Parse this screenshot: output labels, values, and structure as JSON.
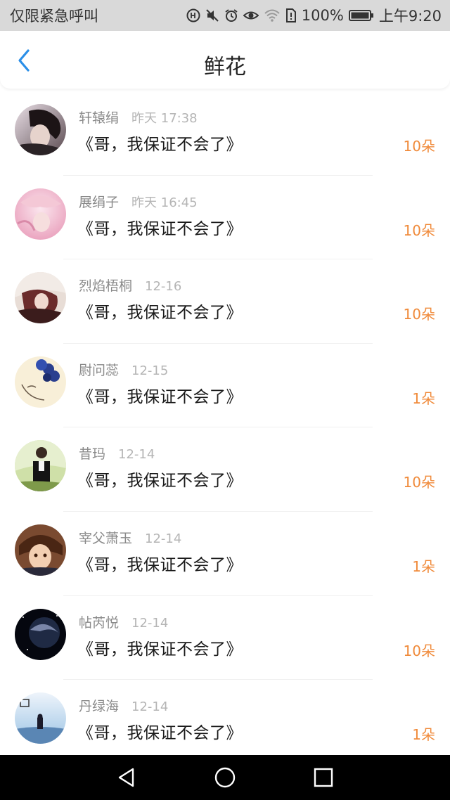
{
  "status_bar": {
    "left_text": "仅限紧急呼叫",
    "battery_text": "100%",
    "time": "上午9:20",
    "icons": [
      "hd-icon",
      "mute-icon",
      "alarm-icon",
      "eye-icon",
      "wifi-icon",
      "sim-icon",
      "battery-icon"
    ]
  },
  "header": {
    "title": "鲜花",
    "back_icon": "chevron-left-icon",
    "accent_color": "#2b8fe8"
  },
  "items": [
    {
      "sender": "轩辕绢",
      "time": "昨天 17:38",
      "message": "《哥，我保证不会了》",
      "count": "10朵"
    },
    {
      "sender": "展绢子",
      "time": "昨天 16:45",
      "message": "《哥，我保证不会了》",
      "count": "10朵"
    },
    {
      "sender": "烈焰梧桐",
      "time": "12-16",
      "message": "《哥，我保证不会了》",
      "count": "10朵"
    },
    {
      "sender": "尉问蕊",
      "time": "12-15",
      "message": "《哥，我保证不会了》",
      "count": "1朵"
    },
    {
      "sender": "昔玛",
      "time": "12-14",
      "message": "《哥，我保证不会了》",
      "count": "10朵"
    },
    {
      "sender": "宰父萧玉",
      "time": "12-14",
      "message": "《哥，我保证不会了》",
      "count": "1朵"
    },
    {
      "sender": "帖芮悦",
      "time": "12-14",
      "message": "《哥，我保证不会了》",
      "count": "10朵"
    },
    {
      "sender": "丹绿海",
      "time": "12-14",
      "message": "《哥，我保证不会了》",
      "count": "1朵"
    }
  ],
  "count_color": "#f08a3a",
  "nav_bar": {
    "buttons": [
      "back-triangle-icon",
      "home-circle-icon",
      "recents-square-icon"
    ]
  }
}
